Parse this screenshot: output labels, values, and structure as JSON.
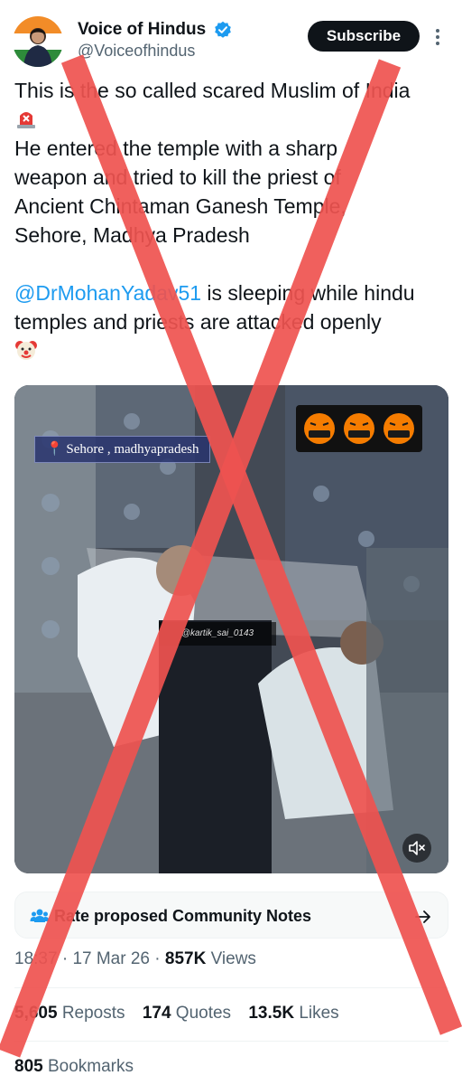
{
  "author": {
    "display_name": "Voice of Hindus",
    "handle": "@Voiceofhindus",
    "verified": true
  },
  "subscribe_label": "Subscribe",
  "tweet": {
    "line1": "This is the so called scared Muslim of India",
    "line2_emoji": "police-siren-emoji",
    "line3": "He entered the temple with a sharp",
    "line4": "weapon and tried to kill the priest of",
    "line5": "Ancient Chintaman Ganesh Temple,",
    "line6": "Sehore, Madhya Pradesh",
    "mention": "@DrMohanYadav51",
    "line7_rest": " is sleeping while hindu",
    "line8": "temples and priests are attacked openly",
    "line9_emoji": "clown-face-emoji"
  },
  "media": {
    "location_label": "📍 Sehore , madhyapradesh",
    "watermark": "@kartik_sai_0143",
    "emoji_strip": [
      "cursing-face-emoji",
      "cursing-face-emoji",
      "cursing-face-emoji"
    ]
  },
  "community_notes": {
    "label": "Rate proposed Community Notes"
  },
  "meta": {
    "time": "18:37",
    "date": "17 Mar 26",
    "views_count": "857K",
    "views_label": "Views"
  },
  "stats": {
    "reposts_count": "5,605",
    "reposts_label": "Reposts",
    "quotes_count": "174",
    "quotes_label": "Quotes",
    "likes_count": "13.5K",
    "likes_label": "Likes",
    "bookmarks_count": "805",
    "bookmarks_label": "Bookmarks"
  },
  "colors": {
    "accent": "#1d9bf0",
    "text": "#0f1419",
    "muted": "#536471",
    "strike": "#ef5350"
  }
}
